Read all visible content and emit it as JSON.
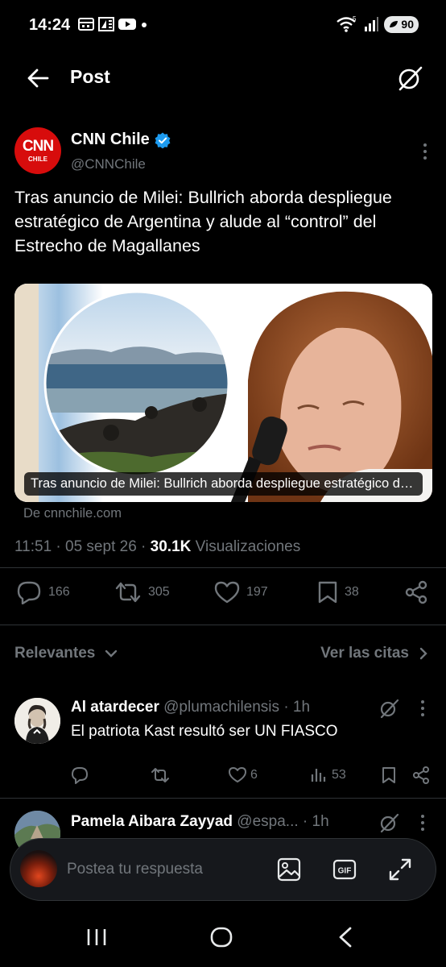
{
  "status": {
    "time": "14:24",
    "battery": "90"
  },
  "header": {
    "title": "Post"
  },
  "author": {
    "name": "CNN Chile",
    "handle": "@CNNChile",
    "avatar_text": "CNN",
    "avatar_subtext": "CHILE"
  },
  "tweet": {
    "text": "Tras anuncio de Milei: Bullrich aborda despliegue estratégico de Argentina y alude al “control” del Estrecho de Magallanes",
    "card_caption": "Tras anuncio de Milei: Bullrich aborda despliegue estratégico de Argentina y alude al “control” del Estrecho de Magallanes",
    "card_source": "De cnnchile.com",
    "time": "11:51 · 05 sept 26 · ",
    "views_count": "30.1K",
    "views_label": " Visualizaciones"
  },
  "actions": {
    "replies": "166",
    "reposts": "305",
    "likes": "197",
    "bookmarks": "38"
  },
  "filters": {
    "relevantes": "Relevantes",
    "citas": "Ver las citas"
  },
  "replies": [
    {
      "name": "Al atardecer",
      "handle": "@plumachilensis",
      "time": "· 1h",
      "text": "El patriota Kast resultó ser UN FIASCO",
      "likes": "6",
      "views": "53"
    },
    {
      "name": "Pamela Aibara Zayyad",
      "handle": "@espa...",
      "time": "· 1h"
    }
  ],
  "compose": {
    "placeholder": "Postea tu respuesta",
    "gif_label": "GIF"
  },
  "colors": {
    "accent": "#1d9bf0",
    "muted": "#71767b",
    "background": "#000000"
  }
}
